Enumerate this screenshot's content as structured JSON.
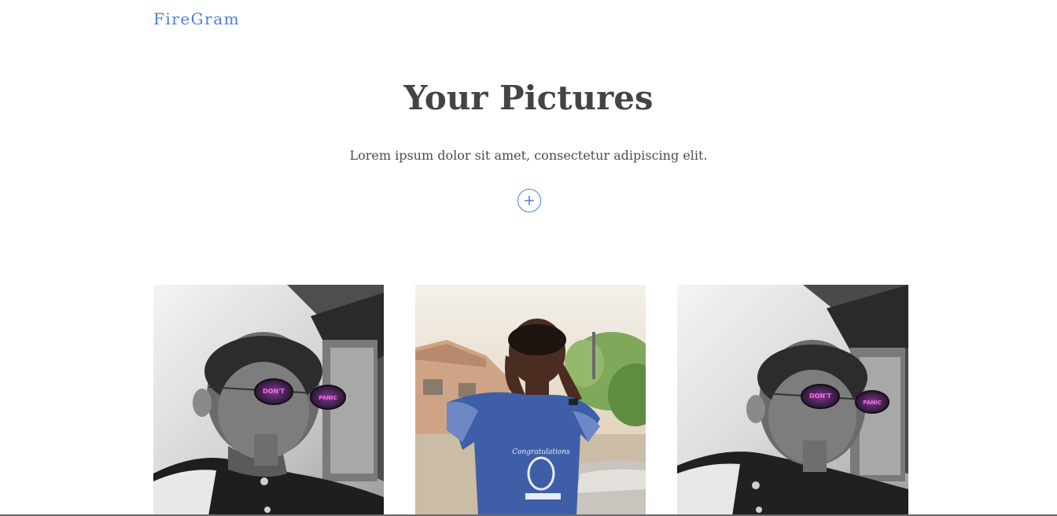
{
  "header": {
    "logo": "FireGram"
  },
  "hero": {
    "title": "Your Pictures",
    "subtitle": "Lorem ipsum dolor sit amet, consectetur adipiscing elit.",
    "add_icon": "plus-icon"
  },
  "gallery": {
    "photos": [
      {
        "glasses_text_left": "DON'T",
        "glasses_text_right": "PANIC"
      },
      {
        "shirt_text": "Congratulations"
      },
      {
        "glasses_text_left": "DON'T",
        "glasses_text_right": "PANIC"
      }
    ]
  },
  "colors": {
    "accent": "#4a7fdc",
    "heading": "#444444",
    "body_text": "#4b4b4b"
  }
}
